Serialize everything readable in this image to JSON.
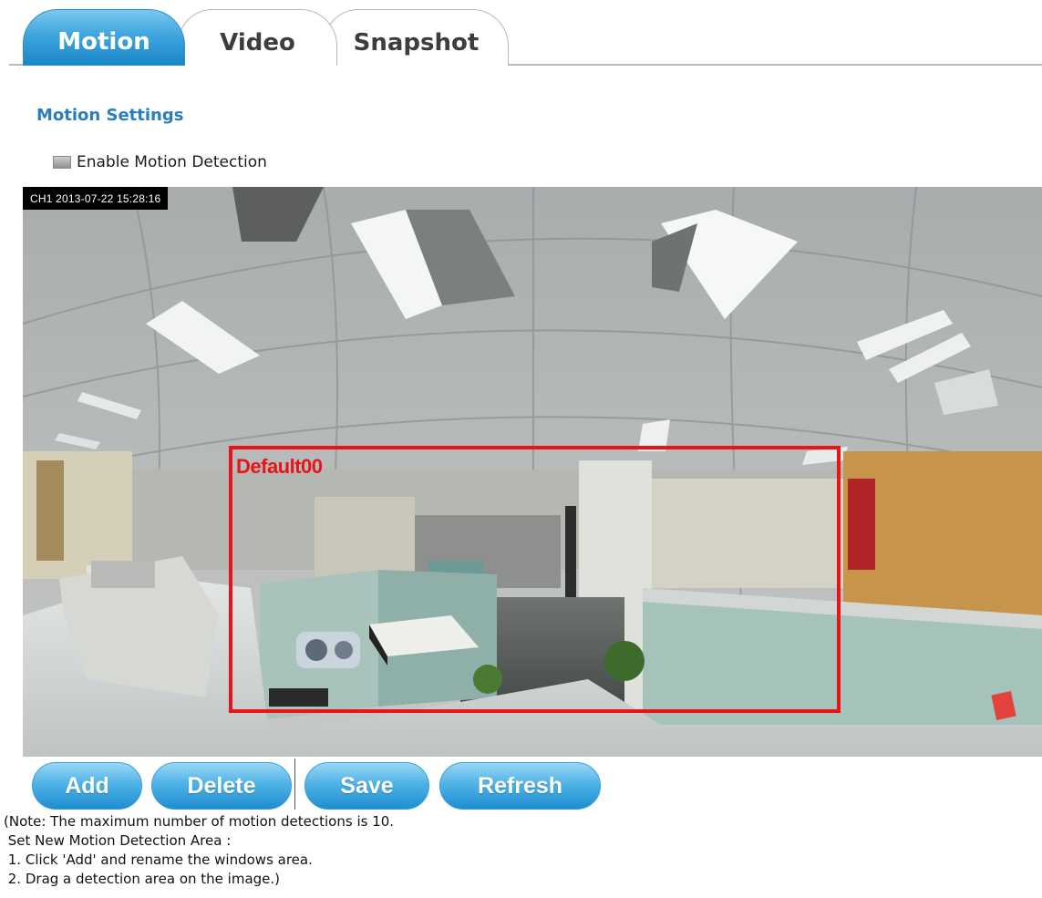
{
  "tabs": [
    {
      "label": "Motion",
      "active": true
    },
    {
      "label": "Video",
      "active": false
    },
    {
      "label": "Snapshot",
      "active": false
    }
  ],
  "section_title": "Motion Settings",
  "enable_motion": {
    "label": "Enable Motion Detection",
    "checked": false
  },
  "camera": {
    "timestamp": "CH1 2013-07-22 15:28:16",
    "detection_area": {
      "name": "Default00",
      "color": "#e8141a"
    }
  },
  "buttons": {
    "add": "Add",
    "delete": "Delete",
    "save": "Save",
    "refresh": "Refresh"
  },
  "notes": [
    "(Note: The maximum number of motion detections is 10.",
    " Set New Motion Detection Area :",
    " 1. Click 'Add' and rename the windows area.",
    " 2. Drag a detection area on the image.)"
  ],
  "colors": {
    "accent": "#2a7ec0",
    "button": "#3fa6de"
  }
}
